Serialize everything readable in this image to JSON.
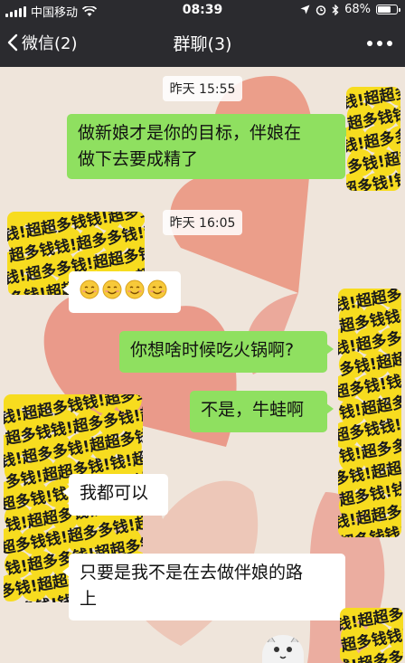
{
  "status_bar": {
    "carrier": "中国移动",
    "time": "08:39",
    "battery_percent": "68%",
    "battery_level": 0.68
  },
  "nav": {
    "back_label": "微信(2)",
    "title": "群聊(3)"
  },
  "avatar_pattern": [
    "钱!超",
    "超多钱",
    "钱!超多",
    "多钱!超",
    "超多钱!"
  ],
  "messages": [
    {
      "type": "timestamp",
      "text": "昨天 15:55"
    },
    {
      "type": "sent",
      "lines": [
        "做新娘才是你的目标，伴娘在",
        "做下去要成精了"
      ]
    },
    {
      "type": "timestamp",
      "text": "昨天 16:05"
    },
    {
      "type": "recv",
      "emoji": "smiley-emoji",
      "count": 4
    },
    {
      "type": "sent",
      "lines": [
        "你想啥时候吃火锅啊?"
      ]
    },
    {
      "type": "sent",
      "lines": [
        "不是，牛蛙啊"
      ]
    },
    {
      "type": "recv",
      "lines": [
        "我都可以"
      ]
    },
    {
      "type": "recv",
      "lines": [
        "只要是我不是在去做伴娘的路",
        "上"
      ]
    }
  ],
  "colors": {
    "nav_bg": "#2b2b2f",
    "chat_bg": "#efe5db",
    "sent_bubble": "#8fe060",
    "recv_bubble": "#ffffff",
    "heart": "#e8806f",
    "avatar_yellow": "#f7dc1f"
  }
}
